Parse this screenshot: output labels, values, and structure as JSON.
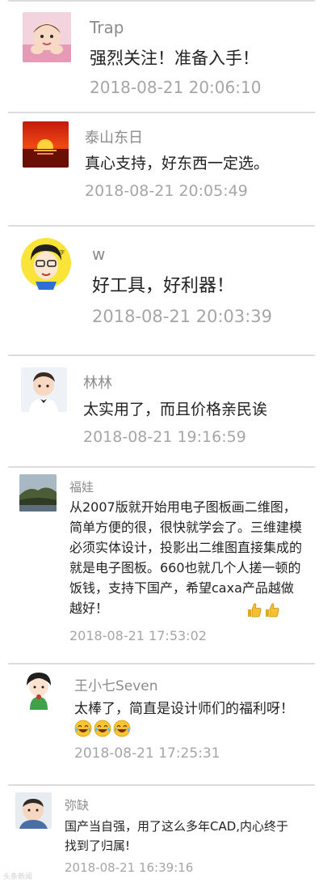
{
  "comments": [
    {
      "name": "Trap",
      "text": "强烈关注！准备入手！",
      "time": "2018-08-21 20:06:10",
      "avatar": "baby-photo"
    },
    {
      "name": "泰山东日",
      "text": "真心支持，好东西一定选。",
      "time": "2018-08-21 20:05:49",
      "avatar": "sunrise-photo"
    },
    {
      "name": "w",
      "text": "好工具，好利器！",
      "time": "2018-08-21 20:03:39",
      "avatar": "cartoon-man"
    },
    {
      "name": "林林",
      "text": "太实用了，而且价格亲民诶",
      "time": "2018-08-21 19:16:59",
      "avatar": "boy-photo"
    },
    {
      "name": "福娃",
      "text": "从2007版就开始用电子图板画二维图，简单方便的很，很快就学会了。三维建模必须实体设计，投影出二维图直接集成的就是电子图板。660也就几个人搓一顿的饭钱，支持下国产，希望caxa产品越做越好！",
      "time": "2018-08-21 17:53:02",
      "avatar": "landscape-photo",
      "emoji": [
        "thumbs-up-icon",
        "thumbs-up-icon"
      ]
    },
    {
      "name": "王小七Seven",
      "text": "太棒了，简直是设计师们的福利呀！",
      "time": "2018-08-21 17:25:31",
      "avatar": "cartoon-girl",
      "emoji": [
        "laugh-cry-icon",
        "laugh-cry-icon",
        "laugh-cry-icon"
      ]
    },
    {
      "name": "弥缺",
      "text": "国产当自强，用了这么多年CAD,内心终于找到了归属!",
      "time": "2018-08-21 16:39:16",
      "avatar": "baby-photo-2"
    }
  ],
  "colors": {
    "name": "#8c8c8c",
    "text": "#222222",
    "time": "#a6a6a6",
    "divider": "#dcdcdc"
  },
  "watermark": "头条新闻"
}
